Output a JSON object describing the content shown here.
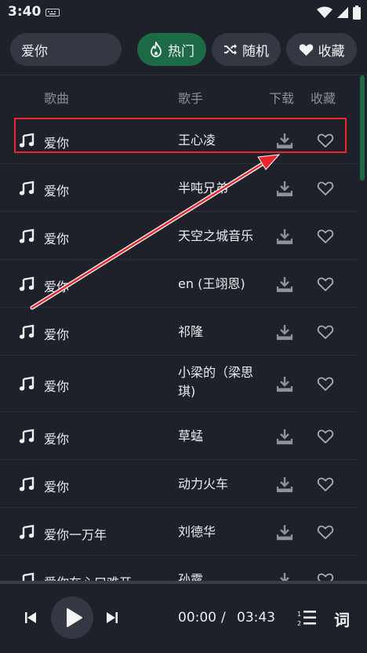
{
  "status_bar": {
    "time": "3:40"
  },
  "search": {
    "value": "爱你"
  },
  "tabs": [
    {
      "label": "热门",
      "icon": "flame-icon",
      "active": true
    },
    {
      "label": "随机",
      "icon": "shuffle-icon",
      "active": false
    },
    {
      "label": "收藏",
      "icon": "heart-icon",
      "active": false
    }
  ],
  "list_header": {
    "song": "歌曲",
    "artist": "歌手",
    "download": "下载",
    "favorite": "收藏"
  },
  "songs": [
    {
      "title": "爱你",
      "artist": "王心凌"
    },
    {
      "title": "爱你",
      "artist": "半吨兄弟"
    },
    {
      "title": "爱你",
      "artist": "天空之城音乐"
    },
    {
      "title": "爱你",
      "artist": "en (王翊恩)"
    },
    {
      "title": "爱你",
      "artist": "祁隆"
    },
    {
      "title": "爱你",
      "artist": "小梁的（梁思琪)"
    },
    {
      "title": "爱你",
      "artist": "草蜢"
    },
    {
      "title": "爱你",
      "artist": "动力火车"
    },
    {
      "title": "爱你一万年",
      "artist": "刘德华"
    },
    {
      "title": "爱你在心口难开",
      "artist": "孙露"
    }
  ],
  "player": {
    "current_time": "00:00",
    "separator": "/",
    "total_time": "03:43",
    "lyrics_label": "词",
    "progress": 0
  },
  "colors": {
    "background": "#1e2129",
    "accent": "#1d6b45",
    "highlight": "#e8262b",
    "surface": "#353842"
  }
}
